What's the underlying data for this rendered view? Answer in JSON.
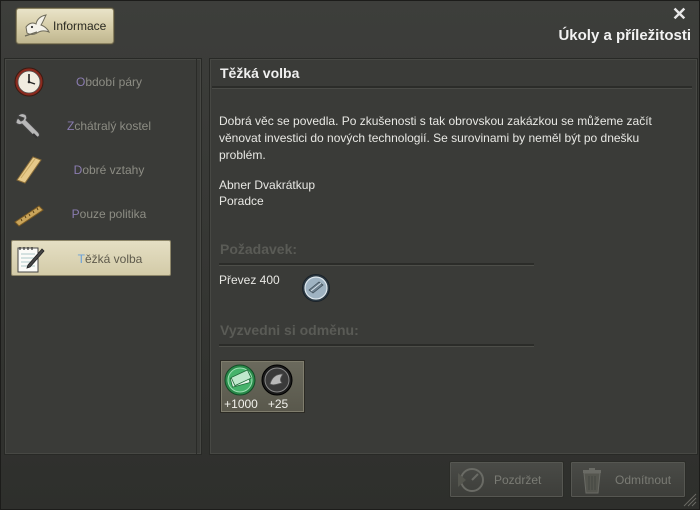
{
  "header": {
    "info_button": "Informace",
    "title": "Úkoly a příležitosti",
    "close": "✕"
  },
  "sidebar": {
    "items": [
      {
        "first": "O",
        "rest": "bdobí páry",
        "icon": "clock-icon",
        "active": false
      },
      {
        "first": "Z",
        "rest": "chátralý kostel",
        "icon": "wrench-icon",
        "active": false
      },
      {
        "first": "D",
        "rest": "obré vztahy",
        "icon": "plank-icon",
        "active": false
      },
      {
        "first": "P",
        "rest": "ouze politika",
        "icon": "ruler-icon",
        "active": false
      },
      {
        "first": "T",
        "rest": "ěžká volba",
        "icon": "notepad-pencil-icon",
        "active": true
      }
    ]
  },
  "quest": {
    "title": "Těžká volba",
    "description": "Dobrá věc se povedla. Po zkušenosti s tak obrovskou zakázkou se můžeme začít věnovat investici do nových technologií. Se surovinami by neměl být po dnešku problém.",
    "author_name": "Abner Dvakrátkup",
    "author_role": "Poradce",
    "requirement_heading": "Požadavek:",
    "requirement_text": "Převez  400",
    "requirement_icon": "steel-coin-icon",
    "reward_heading": "Vyzvedni si odměnu:",
    "rewards": [
      {
        "value": "+1000",
        "icon": "money-coin-icon"
      },
      {
        "value": "+25",
        "icon": "prestige-coin-icon"
      }
    ]
  },
  "footer": {
    "postpone_label": "Pozdržet",
    "reject_label": "Odmítnout"
  },
  "colors": {
    "window_bg": "#363734",
    "active_item_bg": "#ddd6b6",
    "accent_blue": "#6aa0d8",
    "first_letter_purple": "#8a7cb0"
  }
}
